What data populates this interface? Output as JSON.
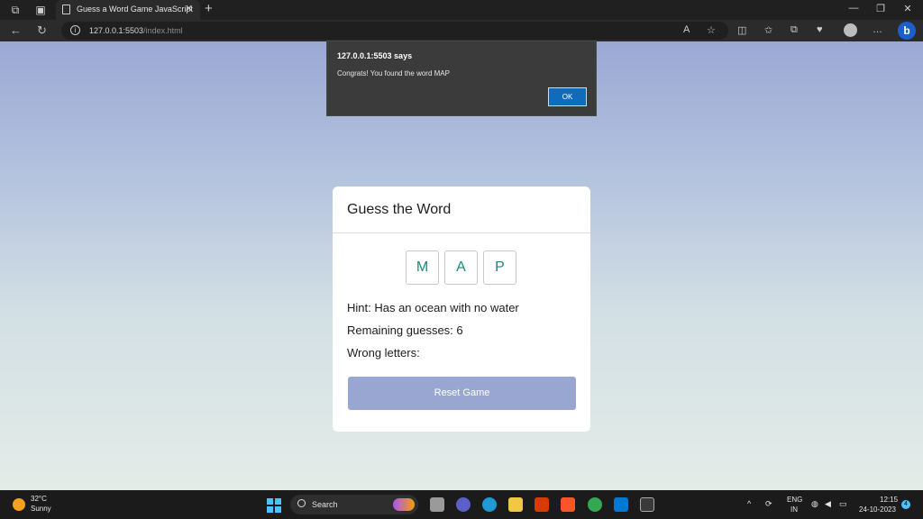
{
  "browser": {
    "tab_title": "Guess a Word Game JavaScript",
    "url_host": "127.0.0.1:5503",
    "url_path": "/index.html"
  },
  "alert": {
    "title": "127.0.0.1:5503 says",
    "message": "Congrats! You found the word MAP",
    "ok_label": "OK"
  },
  "game": {
    "title": "Guess the Word",
    "letters": [
      "M",
      "A",
      "P"
    ],
    "hint": "Hint: Has an ocean with no water",
    "remaining": "Remaining guesses: 6",
    "wrong": "Wrong letters:",
    "reset_label": "Reset Game",
    "colors": {
      "letter": "#1a8a7a",
      "button": "#98a6d1"
    }
  },
  "taskbar": {
    "weather_temp": "32°C",
    "weather_cond": "Sunny",
    "search_label": "Search",
    "lang_top": "ENG",
    "lang_bottom": "IN",
    "time": "12:15",
    "date": "24-10-2023",
    "notification_count": "4"
  }
}
